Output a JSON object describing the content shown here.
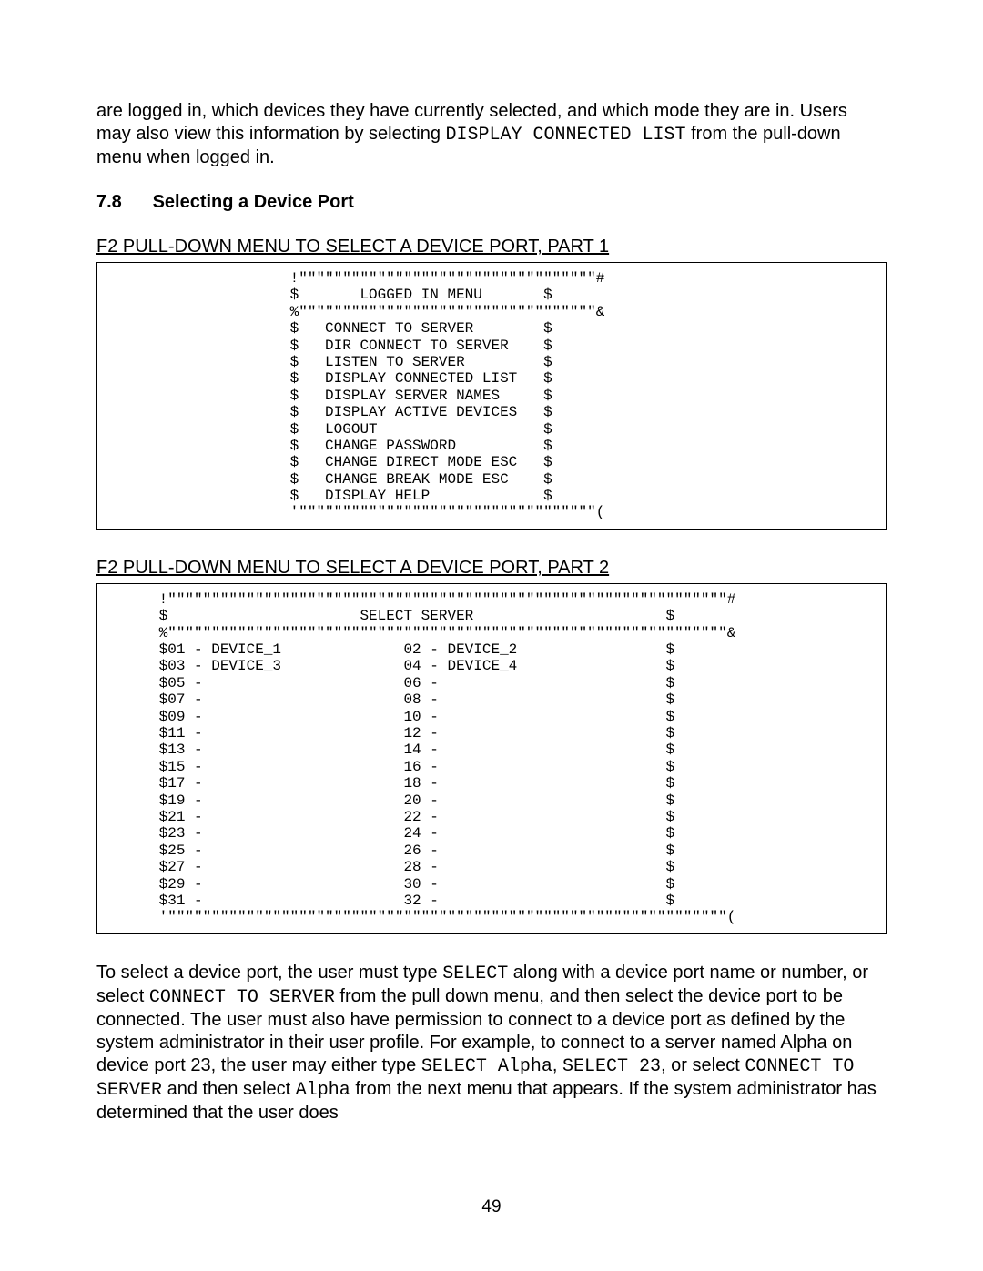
{
  "intro_paragraph_html": "are logged in, which devices they have currently selected, and which mode they are in. Users may also view this information by selecting <span class=\"mono\">DISPLAY CONNECTED LIST</span> from the pull-down menu when logged in.",
  "heading_number": "7.8",
  "heading_title": "Selecting a Device Port",
  "fig1_caption": "F2 PULL-DOWN MENU TO SELECT A DEVICE PORT, PART 1",
  "fig1_text": "                     !\"\"\"\"\"\"\"\"\"\"\"\"\"\"\"\"\"\"\"\"\"\"\"\"\"\"\"\"\"\"\"\"\"\"#\n                     $       LOGGED IN MENU       $\n                     %\"\"\"\"\"\"\"\"\"\"\"\"\"\"\"\"\"\"\"\"\"\"\"\"\"\"\"\"\"\"\"\"\"\"&\n                     $   CONNECT TO SERVER        $\n                     $   DIR CONNECT TO SERVER    $\n                     $   LISTEN TO SERVER         $\n                     $   DISPLAY CONNECTED LIST   $\n                     $   DISPLAY SERVER NAMES     $\n                     $   DISPLAY ACTIVE DEVICES   $\n                     $   LOGOUT                   $\n                     $   CHANGE PASSWORD          $\n                     $   CHANGE DIRECT MODE ESC   $\n                     $   CHANGE BREAK MODE ESC    $\n                     $   DISPLAY HELP             $\n                     '\"\"\"\"\"\"\"\"\"\"\"\"\"\"\"\"\"\"\"\"\"\"\"\"\"\"\"\"\"\"\"\"\"\"(",
  "fig2_caption": "F2 PULL-DOWN MENU TO SELECT A DEVICE PORT, PART 2",
  "fig2_text": "      !\"\"\"\"\"\"\"\"\"\"\"\"\"\"\"\"\"\"\"\"\"\"\"\"\"\"\"\"\"\"\"\"\"\"\"\"\"\"\"\"\"\"\"\"\"\"\"\"\"\"\"\"\"\"\"\"\"\"\"\"\"\"\"\"#\n      $                      SELECT SERVER                      $\n      %\"\"\"\"\"\"\"\"\"\"\"\"\"\"\"\"\"\"\"\"\"\"\"\"\"\"\"\"\"\"\"\"\"\"\"\"\"\"\"\"\"\"\"\"\"\"\"\"\"\"\"\"\"\"\"\"\"\"\"\"\"\"\"\"&\n      $01 - DEVICE_1              02 - DEVICE_2                 $\n      $03 - DEVICE_3              04 - DEVICE_4                 $\n      $05 -                       06 -                          $\n      $07 -                       08 -                          $\n      $09 -                       10 -                          $\n      $11 -                       12 -                          $\n      $13 -                       14 -                          $\n      $15 -                       16 -                          $\n      $17 -                       18 -                          $\n      $19 -                       20 -                          $\n      $21 -                       22 -                          $\n      $23 -                       24 -                          $\n      $25 -                       26 -                          $\n      $27 -                       28 -                          $\n      $29 -                       30 -                          $\n      $31 -                       32 -                          $\n      '\"\"\"\"\"\"\"\"\"\"\"\"\"\"\"\"\"\"\"\"\"\"\"\"\"\"\"\"\"\"\"\"\"\"\"\"\"\"\"\"\"\"\"\"\"\"\"\"\"\"\"\"\"\"\"\"\"\"\"\"\"\"\"\"(",
  "closing_paragraph_html": "To select a device port, the user must type <span class=\"mono\">SELECT</span> along with a device port name or number, or select <span class=\"mono\">CONNECT TO SERVER</span> from the pull down menu, and then select the device port to be connected. The user must also have permission to connect to a device port as defined by the system administrator in their user profile.  For example, to connect to a server named Alpha on device port 23, the user may either type <span class=\"mono\">SELECT Alpha</span>, <span class=\"mono\">SELECT 23</span>, or select <span class=\"mono\">CONNECT TO SERVER</span> and then select <span class=\"mono\">Alpha</span> from the next menu that appears.  If the system administrator has determined that the user does",
  "page_number": "49"
}
